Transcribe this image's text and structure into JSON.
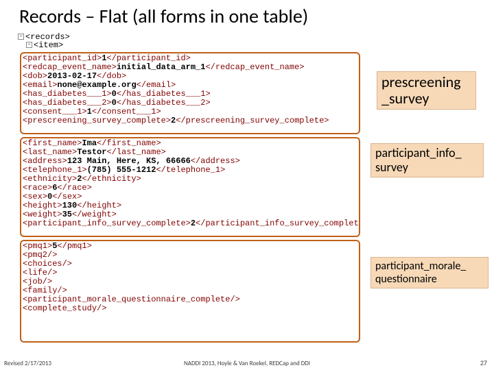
{
  "title": "Records – Flat (all forms in one table)",
  "root": {
    "l1": "<records>",
    "l2": "<item>"
  },
  "labels": {
    "l1a": "prescreening",
    "l1b": "_survey",
    "l2a": "participant_info_",
    "l2b": "survey",
    "l3a": "participant_morale_",
    "l3b": "questionnaire"
  },
  "footer": {
    "left": "Revised 2/17/2013",
    "center": "NADDI 2013, Hoyle & Van Roekel, REDCap and DDI",
    "right": "27"
  },
  "b1": {
    "r1o": "<participant_id>",
    "r1v": "1",
    "r1c": "</participant_id>",
    "r2o": "<redcap_event_name>",
    "r2v": "initial_data_arm_1",
    "r2c": "</redcap_event_name>",
    "r3o": "<dob>",
    "r3v": "2013-02-17",
    "r3c": "</dob>",
    "r4o": "<email>",
    "r4v": "none@example.org",
    "r4c": "</email>",
    "r5o": "<has_diabetes___1>",
    "r5v": "0",
    "r5c": "</has_diabetes___1>",
    "r6o": "<has_diabetes___2>",
    "r6v": "0",
    "r6c": "</has_diabetes___2>",
    "r7o": "<consent___1>",
    "r7v": "1",
    "r7c": "</consent___1>",
    "r8o": "<prescreening_survey_complete>",
    "r8v": "2",
    "r8c": "</prescreening_survey_complete>"
  },
  "b2": {
    "r1o": "<first_name>",
    "r1v": "Ima",
    "r1c": "</first_name>",
    "r2o": "<last_name>",
    "r2v": "Testor",
    "r2c": "</last_name>",
    "r3o": "<address>",
    "r3v": "123 Main, Here, KS, 66666",
    "r3c": "</address>",
    "r4o": "<telephone_1>",
    "r4v": "(785) 555-1212",
    "r4c": "</telephone_1>",
    "r5o": "<ethnicity>",
    "r5v": "2",
    "r5c": "</ethnicity>",
    "r6o": "<race>",
    "r6v": "6",
    "r6c": "</race>",
    "r7o": "<sex>",
    "r7v": "0",
    "r7c": "</sex>",
    "r8o": "<height>",
    "r8v": "130",
    "r8c": "</height>",
    "r9o": "<weight>",
    "r9v": "35",
    "r9c": "</weight>",
    "r10o": "<participant_info_survey_complete>",
    "r10v": "2",
    "r10c": "</participant_info_survey_complete>"
  },
  "b3": {
    "r1o": "<pmq1>",
    "r1v": "5",
    "r1c": "</pmq1>",
    "r2": "<pmq2/>",
    "r3": "<choices/>",
    "r4": "<life/>",
    "r5": "<job/>",
    "r6": "<family/>",
    "r7": "<participant_morale_questionnaire_complete/>",
    "r8": "<complete_study/>"
  }
}
